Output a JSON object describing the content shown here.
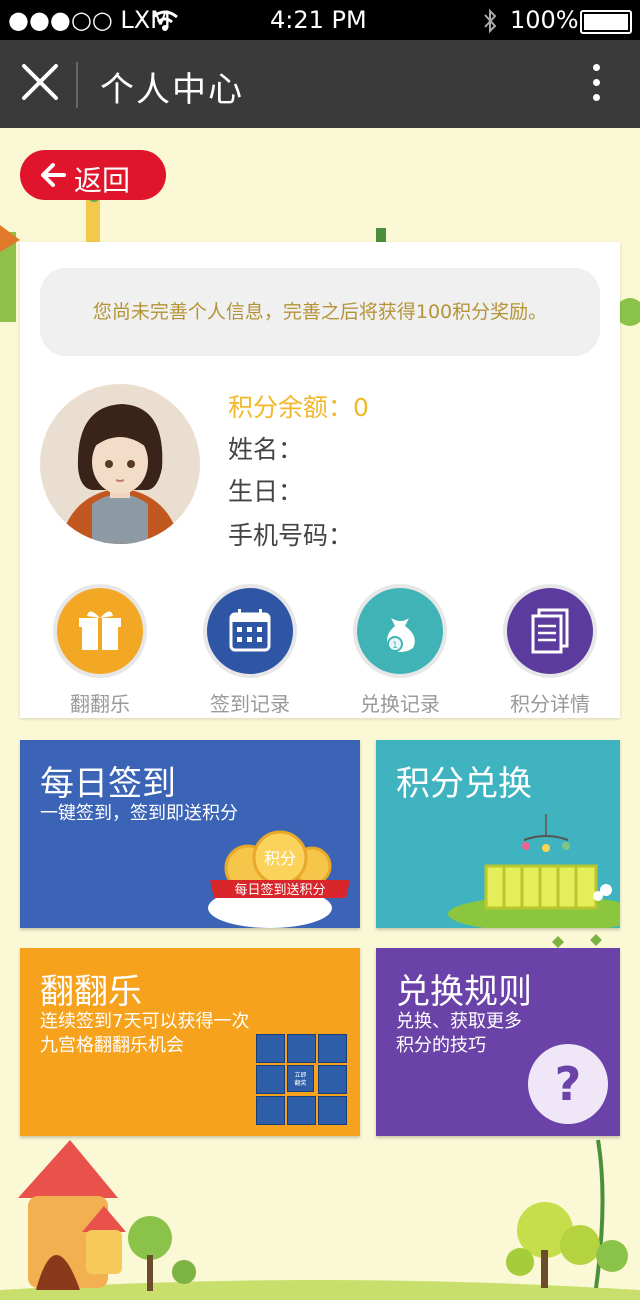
{
  "status_bar": {
    "carrier": "●●●○○ LXM",
    "time": "4:21 PM",
    "battery": "100%"
  },
  "nav": {
    "title": "个人中心"
  },
  "back": {
    "label": "返回"
  },
  "profile": {
    "notice": "您尚未完善个人信息，完善之后将获得100积分奖励。",
    "points_label": "积分余额：",
    "points_value": "0",
    "name_label": "姓名：",
    "birthday_label": "生日：",
    "phone_label": "手机号码："
  },
  "features": [
    {
      "label": "翻翻乐",
      "icon": "gift-icon",
      "color": "#f2a725"
    },
    {
      "label": "签到记录",
      "icon": "calendar-icon",
      "color": "#2f56a5"
    },
    {
      "label": "兑换记录",
      "icon": "money-bag-icon",
      "color": "#3fb3b6"
    },
    {
      "label": "积分详情",
      "icon": "document-icon",
      "color": "#5c3b9e"
    }
  ],
  "tiles": {
    "signin": {
      "title": "每日签到",
      "subtitle": "一键签到，签到即送积分",
      "badge_top": "积分",
      "badge_text": "每日签到送积分",
      "color": "#3b64b6"
    },
    "exchange": {
      "title": "积分兑换",
      "color": "#3fb3bf"
    },
    "flip": {
      "title": "翻翻乐",
      "subtitle_1": "连续签到7天可以获得一次",
      "subtitle_2": "九宫格翻翻乐机会",
      "center_cell": "立即\n翻奖",
      "color": "#f7a21c"
    },
    "rules": {
      "title": "兑换规则",
      "subtitle_1": "兑换、获取更多",
      "subtitle_2": "积分的技巧",
      "help_glyph": "?",
      "color": "#6b43a8"
    }
  }
}
